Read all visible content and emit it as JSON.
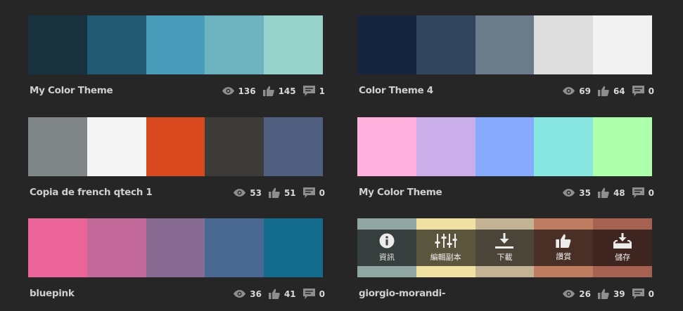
{
  "themes": [
    {
      "title": "My Color Theme",
      "views": "136",
      "likes": "145",
      "comments": "1",
      "colors": [
        "#18313c",
        "#235a73",
        "#489cba",
        "#6cb2bf",
        "#97d2ca"
      ]
    },
    {
      "title": "Color Theme 4",
      "views": "69",
      "likes": "64",
      "comments": "0",
      "colors": [
        "#172440",
        "#33445f",
        "#6b7b89",
        "#dddddd",
        "#f2f2f2"
      ]
    },
    {
      "title": "Copia de french qtech 1",
      "views": "53",
      "likes": "51",
      "comments": "0",
      "colors": [
        "#808588",
        "#f4f4f4",
        "#d9491f",
        "#3c3b39",
        "#515f80"
      ]
    },
    {
      "title": "My Color Theme",
      "views": "35",
      "likes": "48",
      "comments": "0",
      "colors": [
        "#ffb0dd",
        "#c9aeea",
        "#88aafe",
        "#88e6e2",
        "#aeffaa"
      ]
    },
    {
      "title": "bluepink",
      "views": "36",
      "likes": "41",
      "comments": "0",
      "colors": [
        "#ea6497",
        "#c3699a",
        "#876a91",
        "#486791",
        "#136c8e"
      ]
    },
    {
      "title": "giorgio-morandi-",
      "views": "26",
      "likes": "39",
      "comments": "0",
      "colors": [
        "#8fa6a3",
        "#f0e0a2",
        "#c4b295",
        "#c07c61",
        "#a66151"
      ]
    }
  ],
  "hover_actions": [
    {
      "label": "資訊",
      "icon": "info-icon"
    },
    {
      "label": "編輯副本",
      "icon": "sliders-icon"
    },
    {
      "label": "下載",
      "icon": "download-icon"
    },
    {
      "label": "讚賞",
      "icon": "thumbs-up-icon"
    },
    {
      "label": "儲存",
      "icon": "save-to-library-icon"
    }
  ],
  "icon_color": "#8e8e8e"
}
